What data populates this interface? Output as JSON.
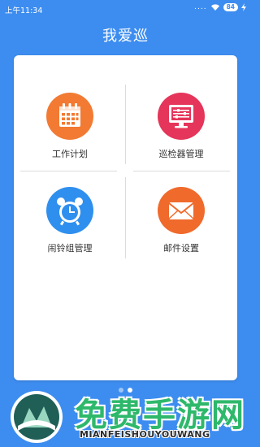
{
  "status": {
    "time": "上午11:34",
    "signal": "....",
    "battery": "84"
  },
  "app": {
    "title": "我爱巡"
  },
  "menu": [
    {
      "label": "工作计划",
      "icon": "calendar-icon",
      "color": "#f27a32"
    },
    {
      "label": "巡检器管理",
      "icon": "monitor-icon",
      "color": "#e5355a"
    },
    {
      "label": "闹铃组管理",
      "icon": "alarm-clock-icon",
      "color": "#2f8fee"
    },
    {
      "label": "邮件设置",
      "icon": "mail-icon",
      "color": "#f06a2c"
    }
  ],
  "pager": {
    "pages": 2,
    "current": 1
  },
  "watermark": {
    "brand": "免费手游网",
    "domain": "MIANFEISHOUYOUWANG"
  }
}
